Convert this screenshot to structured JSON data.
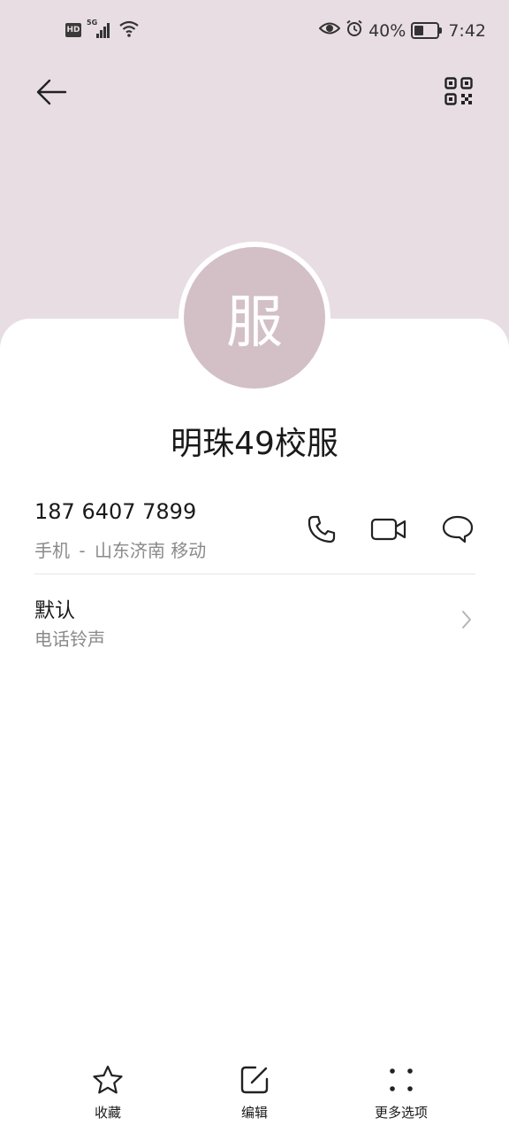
{
  "status_bar": {
    "hd_badge": "HD",
    "network_label": "5G",
    "battery_percent_text": "40%",
    "battery_level": 0.4,
    "time": "7:42"
  },
  "header": {
    "back_icon": "arrow-left-icon",
    "qr_icon": "qr-code-icon",
    "background_color": "#e7dde2"
  },
  "contact": {
    "avatar_char": "服",
    "avatar_color": "#d3c0c7",
    "name": "明珠49校服"
  },
  "phone": {
    "number": "187 6407 7899",
    "type": "手机",
    "separator": "-",
    "location": "山东济南 移动",
    "actions": [
      "phone-icon",
      "video-call-icon",
      "message-icon"
    ]
  },
  "ringtone": {
    "value": "默认",
    "label": "电话铃声"
  },
  "bottom_bar": {
    "items": [
      {
        "label": "收藏",
        "icon": "star-icon"
      },
      {
        "label": "编辑",
        "icon": "edit-icon"
      },
      {
        "label": "更多选项",
        "icon": "more-options-icon"
      }
    ]
  }
}
